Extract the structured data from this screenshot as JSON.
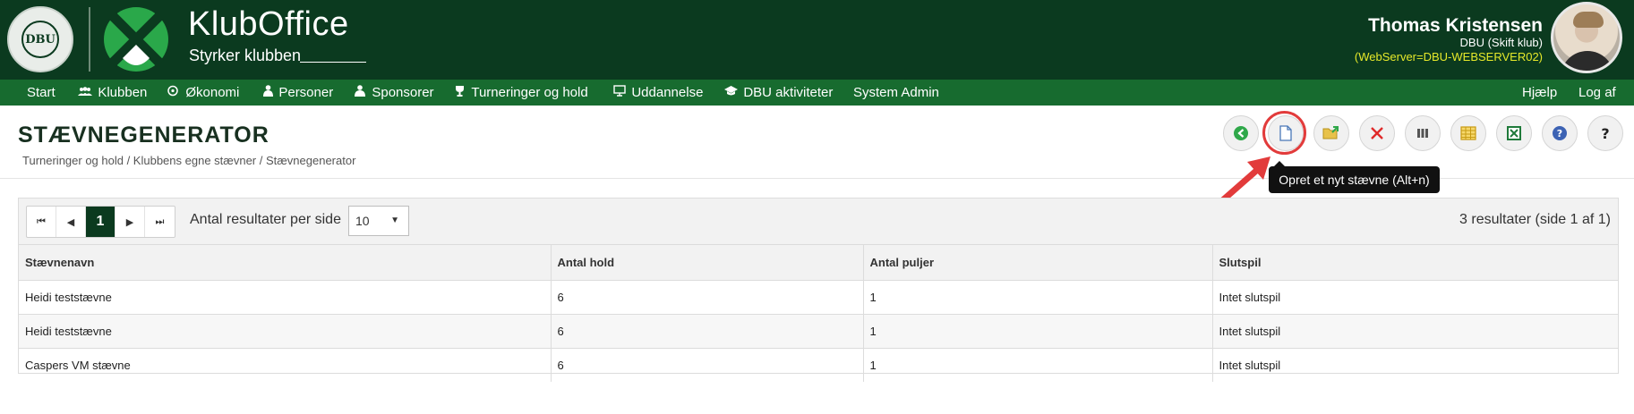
{
  "header": {
    "dbu_logo_text": "DBU",
    "brand": "KlubOffice",
    "slogan": "Styrker klubben",
    "user_name": "Thomas Kristensen",
    "user_club": "DBU (Skift klub)",
    "user_server": "(WebServer=DBU-WEBSERVER02)"
  },
  "nav": {
    "items": [
      {
        "label": "Start",
        "icon": ""
      },
      {
        "label": "Klubben",
        "icon": "users-icon"
      },
      {
        "label": "Økonomi",
        "icon": "coins-icon"
      },
      {
        "label": "Personer",
        "icon": "person-icon"
      },
      {
        "label": "Sponsorer",
        "icon": "sponsor-icon"
      },
      {
        "label": "Turneringer og hold",
        "icon": "trophy-icon"
      },
      {
        "label": "Uddannelse",
        "icon": "presentation-icon"
      },
      {
        "label": "DBU aktiviteter",
        "icon": "graduation-cap-icon"
      },
      {
        "label": "System Admin",
        "icon": ""
      }
    ],
    "right_items": [
      {
        "label": "Hjælp"
      },
      {
        "label": "Log af"
      }
    ]
  },
  "page": {
    "title": "STÆVNEGENERATOR",
    "breadcrumb": "Turneringer og hold / Klubbens egne stævner / Stævnegenerator"
  },
  "toolbar": {
    "buttons": [
      "back-icon",
      "new-document-icon",
      "open-folder-icon",
      "delete-icon",
      "columns-icon",
      "table-icon",
      "excel-export-icon",
      "help-circle-icon",
      "question-icon"
    ],
    "tooltip": "Opret et nyt stævne (Alt+n)",
    "highlight_color": "#e23b3b"
  },
  "pager": {
    "first": "⏮",
    "prev": "◀",
    "current_page": "1",
    "next": "▶",
    "last": "⏭",
    "per_page_label": "Antal resultater per side",
    "per_page_value": "10",
    "result_count": "3 resultater (side 1 af 1)"
  },
  "table": {
    "columns": [
      "Stævnenavn",
      "Antal hold",
      "Antal puljer",
      "Slutspil"
    ],
    "rows": [
      [
        "Heidi teststævne",
        "6",
        "1",
        "Intet slutspil"
      ],
      [
        "Heidi teststævne",
        "6",
        "1",
        "Intet slutspil"
      ],
      [
        "Caspers VM stævne",
        "6",
        "1",
        "Intet slutspil"
      ]
    ]
  },
  "colors": {
    "header_bg": "#0b3a1f",
    "nav_bg": "#176b2f",
    "server_text": "#e6e92a"
  }
}
